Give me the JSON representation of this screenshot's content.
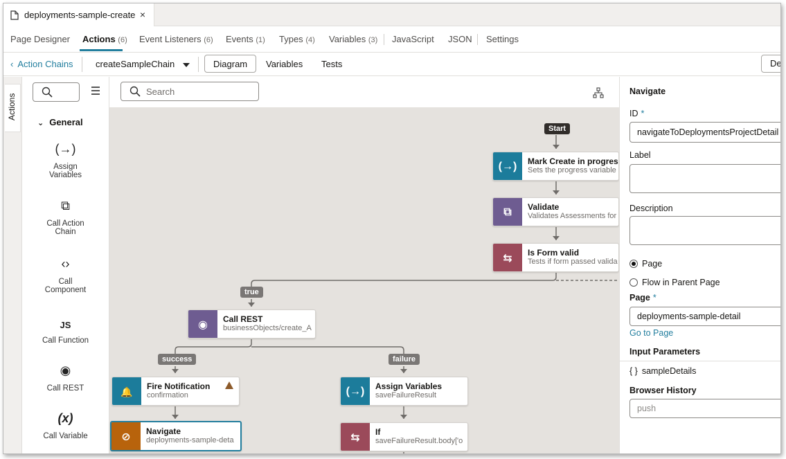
{
  "file_tab": {
    "name": "deployments-sample-create",
    "close": "×"
  },
  "sub_tabs": [
    {
      "label": "Page Designer",
      "count": ""
    },
    {
      "label": "Actions",
      "count": "(6)"
    },
    {
      "label": "Event Listeners",
      "count": "(6)"
    },
    {
      "label": "Events",
      "count": "(1)"
    },
    {
      "label": "Types",
      "count": "(4)"
    },
    {
      "label": "Variables",
      "count": "(3)"
    },
    {
      "label": "JavaScript",
      "count": ""
    },
    {
      "label": "JSON",
      "count": ""
    },
    {
      "label": "Settings",
      "count": ""
    }
  ],
  "toolbar": {
    "back_label": "Action Chains",
    "chain_name": "createSampleChain",
    "views": [
      "Diagram",
      "Variables",
      "Tests"
    ],
    "right_button": "De"
  },
  "side_tab": "Actions",
  "palette": {
    "group": "General",
    "items": [
      {
        "label_line1": "Assign",
        "label_line2": "Variables",
        "glyph": "(→)"
      },
      {
        "label_line1": "Call Action",
        "label_line2": "Chain",
        "glyph": "⧉"
      },
      {
        "label_line1": "Call",
        "label_line2": "Component",
        "glyph": "‹›"
      },
      {
        "label_line1": "Call Function",
        "label_line2": "",
        "glyph": "JS"
      },
      {
        "label_line1": "Call REST",
        "label_line2": "",
        "glyph": "◉"
      },
      {
        "label_line1": "Call Variable",
        "label_line2": "",
        "glyph": "(x)"
      }
    ]
  },
  "canvas": {
    "search_placeholder": "Search",
    "start_label": "Start",
    "nodes": [
      {
        "title": "Mark Create in progress",
        "subtitle": "Sets the progress variable t",
        "color": "#1c7c9b",
        "glyph": "(→)"
      },
      {
        "title": "Validate",
        "subtitle": "Validates Assessments for",
        "color": "#6e5c91",
        "glyph": "⧉"
      },
      {
        "title": "Is Form valid",
        "subtitle": "Tests if form passed valida",
        "color": "#9b4a5a",
        "glyph": "⇆"
      },
      {
        "title": "Call REST",
        "subtitle": "businessObjects/create_A",
        "color": "#6e5c91",
        "glyph": "◉"
      },
      {
        "title": "Fire Notification",
        "subtitle": "confirmation",
        "color": "#1c7c9b",
        "glyph": "🔔"
      },
      {
        "title": "Assign Variables",
        "subtitle": "saveFailureResult",
        "color": "#1c7c9b",
        "glyph": "(→)"
      },
      {
        "title": "Navigate",
        "subtitle": "deployments-sample-deta",
        "color": "#b8630c",
        "glyph": "⊘"
      },
      {
        "title": "If",
        "subtitle": "saveFailureResult.body['o",
        "color": "#9b4a5a",
        "glyph": "⇆"
      }
    ],
    "branch_labels": [
      "true",
      "success",
      "failure"
    ]
  },
  "properties": {
    "title": "Navigate",
    "id_label": "ID",
    "id_value": "navigateToDeploymentsProjectDetail",
    "label_label": "Label",
    "label_value": "",
    "description_label": "Description",
    "description_value": "",
    "radio_page": "Page",
    "radio_flow": "Flow in Parent Page",
    "page_label": "Page",
    "page_value": "deployments-sample-detail",
    "go_to_page": "Go to Page",
    "input_params_label": "Input Parameters",
    "input_param_braces": "{ }",
    "input_param": "sampleDetails",
    "browser_history_label": "Browser History",
    "browser_history_placeholder": "push",
    "required_mark": "*"
  },
  "colors": {
    "accent": "#227e9e",
    "canvas_bg": "#e5e2de"
  }
}
